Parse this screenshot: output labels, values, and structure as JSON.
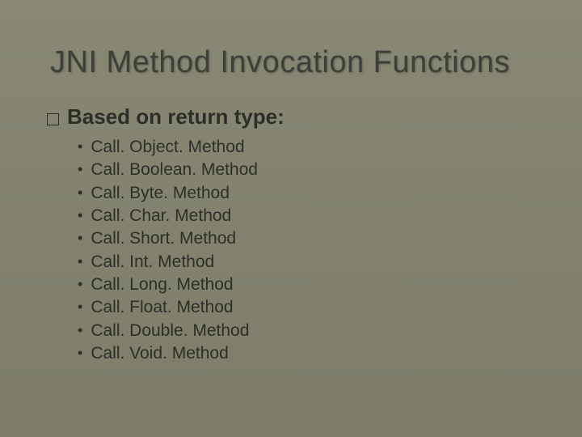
{
  "title": "JNI Method Invocation Functions",
  "subhead_prefix": "Based",
  "subhead_rest": "on return type:",
  "items": [
    "Call. Object. Method",
    "Call. Boolean. Method",
    "Call. Byte. Method",
    "Call. Char. Method",
    "Call. Short. Method",
    "Call. Int. Method",
    "Call. Long. Method",
    "Call. Float. Method",
    "Call. Double. Method",
    "Call. Void. Method"
  ]
}
